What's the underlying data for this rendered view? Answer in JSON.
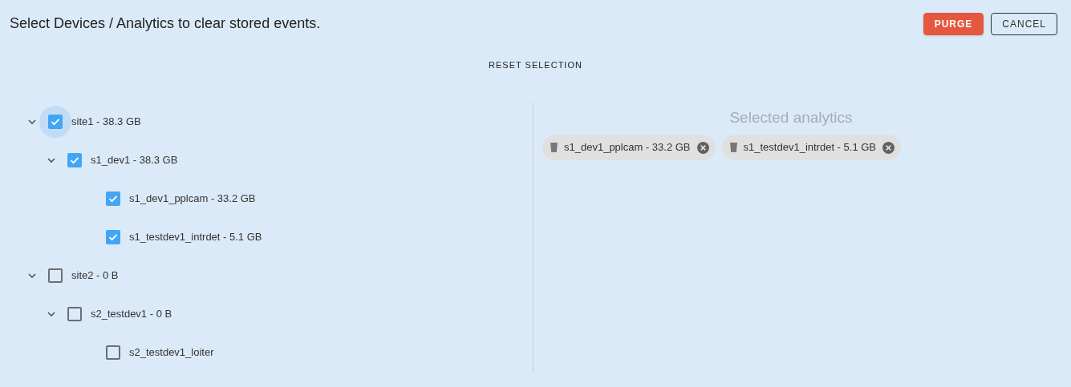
{
  "header": {
    "title": "Select Devices / Analytics to clear stored events.",
    "buttons": [
      {
        "label": "PURGE",
        "kind": "primary"
      },
      {
        "label": "CANCEL",
        "kind": "outline"
      }
    ]
  },
  "reset_button": "RESET SELECTION",
  "tree": [
    {
      "label": "site1 - 38.3 GB",
      "checked": true,
      "focused": true,
      "expanded": true,
      "children": [
        {
          "label": "s1_dev1 - 38.3 GB",
          "checked": true,
          "focused": false,
          "expanded": true,
          "children": [
            {
              "label": "s1_dev1_pplcam - 33.2 GB",
              "checked": true,
              "focused": false
            },
            {
              "label": "s1_testdev1_intrdet - 5.1 GB",
              "checked": true,
              "focused": false
            }
          ]
        }
      ]
    },
    {
      "label": "site2 - 0 B",
      "checked": false,
      "focused": false,
      "expanded": true,
      "children": [
        {
          "label": "s2_testdev1 - 0 B",
          "checked": false,
          "focused": false,
          "expanded": true,
          "children": [
            {
              "label": "s2_testdev1_loiter",
              "checked": false,
              "focused": false
            }
          ]
        }
      ]
    }
  ],
  "selected_panel": {
    "heading": "Selected analytics",
    "chips": [
      {
        "label": "s1_dev1_pplcam - 33.2 GB"
      },
      {
        "label": "s1_testdev1_intrdet - 5.1 GB"
      }
    ]
  }
}
